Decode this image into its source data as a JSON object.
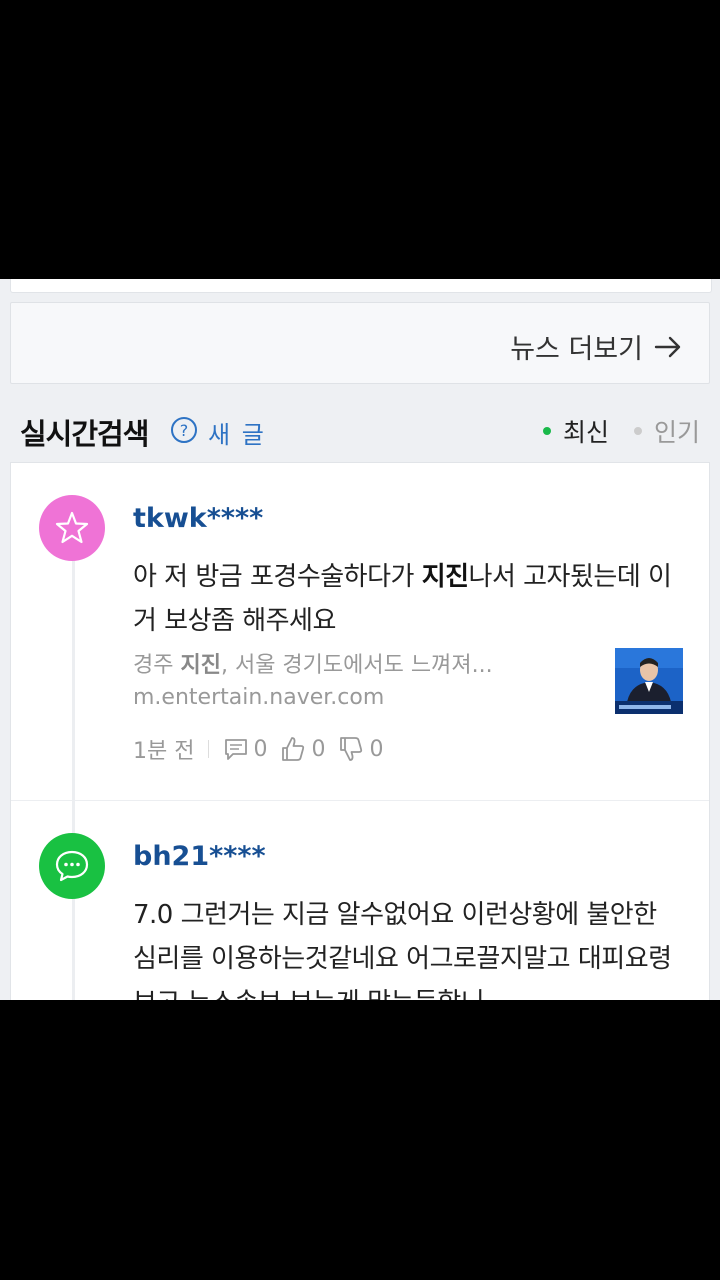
{
  "more_news": {
    "label": "뉴스 더보기"
  },
  "section": {
    "title": "실시간검색",
    "new_post": "새 글",
    "sort_latest": "최신",
    "sort_popular": "인기"
  },
  "comments": [
    {
      "username": "tkwk****",
      "text_pre": "아 저 방금 포경수술하다가 ",
      "text_bold": "지진",
      "text_post": "나서 고자됬는데 이거 보상좀 해주세요",
      "link_title_pre": "경주 ",
      "link_title_bold": "지진",
      "link_title_post": ", 서울 경기도에서도 느껴져...",
      "link_url": "m.entertain.naver.com",
      "time": "1분 전",
      "reply_count": "0",
      "like_count": "0",
      "dislike_count": "0",
      "avatar_icon": "star-icon",
      "avatar_color": "#ef73d6"
    },
    {
      "username": "bh21****",
      "text": "7.0 그런거는 지금 알수없어요 이런상황에 불안한 심리를 이용하는것같네요 어그로끌지말고 대피요령보고 뉴스속보 보는게 맞는듯합니",
      "avatar_icon": "chat-bubble-icon",
      "avatar_color": "#19c142"
    }
  ],
  "colors": {
    "accent_blue": "#2e73c4",
    "username_blue": "#174f93",
    "green": "#19b94a"
  }
}
